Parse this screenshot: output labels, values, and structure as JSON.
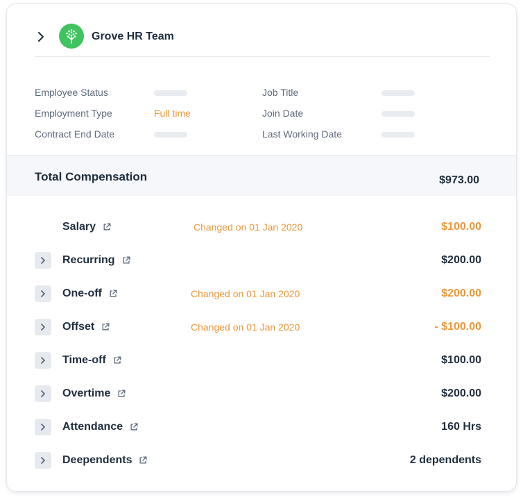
{
  "header": {
    "team_name": "Grove HR Team"
  },
  "info": {
    "left": [
      {
        "label": "Employee Status",
        "value": ""
      },
      {
        "label": "Employment Type",
        "value": "Full time"
      },
      {
        "label": "Contract End Date",
        "value": ""
      }
    ],
    "right": [
      {
        "label": "Job Title",
        "value": ""
      },
      {
        "label": "Join Date",
        "value": ""
      },
      {
        "label": "Last Working Date",
        "value": ""
      }
    ]
  },
  "total": {
    "label": "Total Compensation",
    "value": "$973.00"
  },
  "rows": [
    {
      "label": "Salary",
      "changed": "Changed on 01 Jan 2020",
      "amount": "$100.00",
      "highlight": true,
      "expandable": false
    },
    {
      "label": "Recurring",
      "changed": "",
      "amount": "$200.00",
      "highlight": false,
      "expandable": true
    },
    {
      "label": "One-off",
      "changed": "Changed on 01 Jan 2020",
      "amount": "$200.00",
      "highlight": true,
      "expandable": true
    },
    {
      "label": "Offset",
      "changed": "Changed on 01 Jan 2020",
      "amount": "- $100.00",
      "highlight": true,
      "expandable": true
    },
    {
      "label": "Time-off",
      "changed": "",
      "amount": "$100.00",
      "highlight": false,
      "expandable": true
    },
    {
      "label": "Overtime",
      "changed": "",
      "amount": "$200.00",
      "highlight": false,
      "expandable": true
    },
    {
      "label": "Attendance",
      "changed": "",
      "amount": "160 Hrs",
      "highlight": false,
      "expandable": true
    },
    {
      "label": "Deependents",
      "changed": "",
      "amount": "2 dependents",
      "highlight": false,
      "expandable": true
    }
  ],
  "colors": {
    "accent": "#f0963a",
    "brand": "#3fc45f",
    "text": "#1f2d3d"
  },
  "icons": {
    "header_toggle": "chevron-right-icon",
    "logo": "tree-logo-icon",
    "expander": "chevron-right-icon",
    "link": "external-link-icon"
  }
}
